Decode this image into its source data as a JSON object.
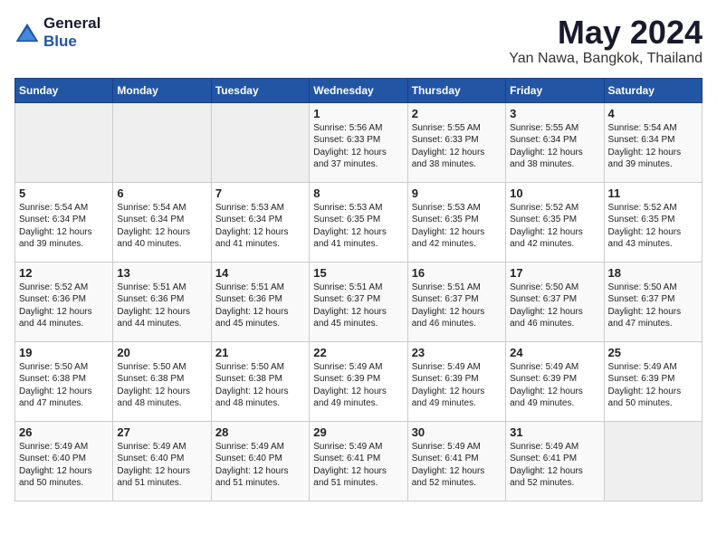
{
  "logo": {
    "general": "General",
    "blue": "Blue"
  },
  "title": "May 2024",
  "subtitle": "Yan Nawa, Bangkok, Thailand",
  "headers": [
    "Sunday",
    "Monday",
    "Tuesday",
    "Wednesday",
    "Thursday",
    "Friday",
    "Saturday"
  ],
  "weeks": [
    [
      {
        "day": "",
        "info": ""
      },
      {
        "day": "",
        "info": ""
      },
      {
        "day": "",
        "info": ""
      },
      {
        "day": "1",
        "info": "Sunrise: 5:56 AM\nSunset: 6:33 PM\nDaylight: 12 hours\nand 37 minutes."
      },
      {
        "day": "2",
        "info": "Sunrise: 5:55 AM\nSunset: 6:33 PM\nDaylight: 12 hours\nand 38 minutes."
      },
      {
        "day": "3",
        "info": "Sunrise: 5:55 AM\nSunset: 6:34 PM\nDaylight: 12 hours\nand 38 minutes."
      },
      {
        "day": "4",
        "info": "Sunrise: 5:54 AM\nSunset: 6:34 PM\nDaylight: 12 hours\nand 39 minutes."
      }
    ],
    [
      {
        "day": "5",
        "info": "Sunrise: 5:54 AM\nSunset: 6:34 PM\nDaylight: 12 hours\nand 39 minutes."
      },
      {
        "day": "6",
        "info": "Sunrise: 5:54 AM\nSunset: 6:34 PM\nDaylight: 12 hours\nand 40 minutes."
      },
      {
        "day": "7",
        "info": "Sunrise: 5:53 AM\nSunset: 6:34 PM\nDaylight: 12 hours\nand 41 minutes."
      },
      {
        "day": "8",
        "info": "Sunrise: 5:53 AM\nSunset: 6:35 PM\nDaylight: 12 hours\nand 41 minutes."
      },
      {
        "day": "9",
        "info": "Sunrise: 5:53 AM\nSunset: 6:35 PM\nDaylight: 12 hours\nand 42 minutes."
      },
      {
        "day": "10",
        "info": "Sunrise: 5:52 AM\nSunset: 6:35 PM\nDaylight: 12 hours\nand 42 minutes."
      },
      {
        "day": "11",
        "info": "Sunrise: 5:52 AM\nSunset: 6:35 PM\nDaylight: 12 hours\nand 43 minutes."
      }
    ],
    [
      {
        "day": "12",
        "info": "Sunrise: 5:52 AM\nSunset: 6:36 PM\nDaylight: 12 hours\nand 44 minutes."
      },
      {
        "day": "13",
        "info": "Sunrise: 5:51 AM\nSunset: 6:36 PM\nDaylight: 12 hours\nand 44 minutes."
      },
      {
        "day": "14",
        "info": "Sunrise: 5:51 AM\nSunset: 6:36 PM\nDaylight: 12 hours\nand 45 minutes."
      },
      {
        "day": "15",
        "info": "Sunrise: 5:51 AM\nSunset: 6:37 PM\nDaylight: 12 hours\nand 45 minutes."
      },
      {
        "day": "16",
        "info": "Sunrise: 5:51 AM\nSunset: 6:37 PM\nDaylight: 12 hours\nand 46 minutes."
      },
      {
        "day": "17",
        "info": "Sunrise: 5:50 AM\nSunset: 6:37 PM\nDaylight: 12 hours\nand 46 minutes."
      },
      {
        "day": "18",
        "info": "Sunrise: 5:50 AM\nSunset: 6:37 PM\nDaylight: 12 hours\nand 47 minutes."
      }
    ],
    [
      {
        "day": "19",
        "info": "Sunrise: 5:50 AM\nSunset: 6:38 PM\nDaylight: 12 hours\nand 47 minutes."
      },
      {
        "day": "20",
        "info": "Sunrise: 5:50 AM\nSunset: 6:38 PM\nDaylight: 12 hours\nand 48 minutes."
      },
      {
        "day": "21",
        "info": "Sunrise: 5:50 AM\nSunset: 6:38 PM\nDaylight: 12 hours\nand 48 minutes."
      },
      {
        "day": "22",
        "info": "Sunrise: 5:49 AM\nSunset: 6:39 PM\nDaylight: 12 hours\nand 49 minutes."
      },
      {
        "day": "23",
        "info": "Sunrise: 5:49 AM\nSunset: 6:39 PM\nDaylight: 12 hours\nand 49 minutes."
      },
      {
        "day": "24",
        "info": "Sunrise: 5:49 AM\nSunset: 6:39 PM\nDaylight: 12 hours\nand 49 minutes."
      },
      {
        "day": "25",
        "info": "Sunrise: 5:49 AM\nSunset: 6:39 PM\nDaylight: 12 hours\nand 50 minutes."
      }
    ],
    [
      {
        "day": "26",
        "info": "Sunrise: 5:49 AM\nSunset: 6:40 PM\nDaylight: 12 hours\nand 50 minutes."
      },
      {
        "day": "27",
        "info": "Sunrise: 5:49 AM\nSunset: 6:40 PM\nDaylight: 12 hours\nand 51 minutes."
      },
      {
        "day": "28",
        "info": "Sunrise: 5:49 AM\nSunset: 6:40 PM\nDaylight: 12 hours\nand 51 minutes."
      },
      {
        "day": "29",
        "info": "Sunrise: 5:49 AM\nSunset: 6:41 PM\nDaylight: 12 hours\nand 51 minutes."
      },
      {
        "day": "30",
        "info": "Sunrise: 5:49 AM\nSunset: 6:41 PM\nDaylight: 12 hours\nand 52 minutes."
      },
      {
        "day": "31",
        "info": "Sunrise: 5:49 AM\nSunset: 6:41 PM\nDaylight: 12 hours\nand 52 minutes."
      },
      {
        "day": "",
        "info": ""
      }
    ]
  ]
}
